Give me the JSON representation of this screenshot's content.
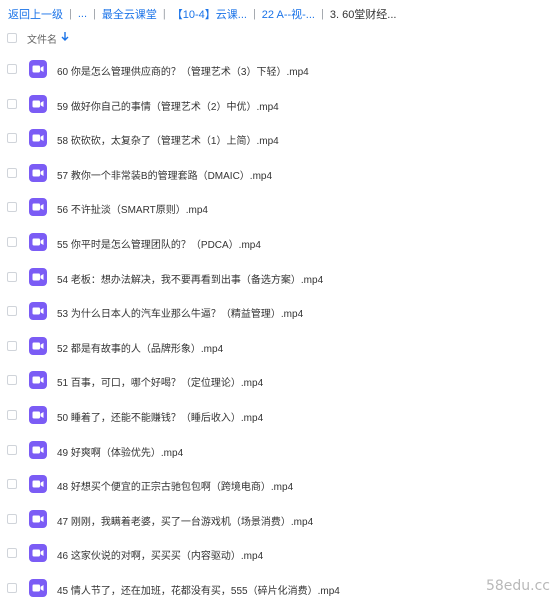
{
  "breadcrumb": {
    "items": [
      "返回上一级",
      "...",
      "最全云课堂",
      "【10-4】云课...",
      "22 A--视-...",
      "3. 60堂财经..."
    ],
    "separator": "|",
    "current_index": 5
  },
  "header": {
    "column_title": "文件名",
    "sort_icon": "arrow-down-icon"
  },
  "files": [
    {
      "name": "60 你是怎么管理供应商的？（管理艺术（3）下轻）.mp4",
      "icon": "video-icon"
    },
    {
      "name": "59 做好你自己的事情（管理艺术（2）中优）.mp4",
      "icon": "video-icon"
    },
    {
      "name": "58 砍砍砍，太复杂了（管理艺术（1）上简）.mp4",
      "icon": "video-icon"
    },
    {
      "name": "57 教你一个非常装B的管理套路（DMAIC）.mp4",
      "icon": "video-icon"
    },
    {
      "name": "56 不许扯淡（SMART原则）.mp4",
      "icon": "video-icon"
    },
    {
      "name": "55 你平时是怎么管理团队的？（PDCA）.mp4",
      "icon": "video-icon"
    },
    {
      "name": "54 老板：想办法解决，我不要再看到出事（备选方案）.mp4",
      "icon": "video-icon"
    },
    {
      "name": "53 为什么日本人的汽车业那么牛逼？（精益管理）.mp4",
      "icon": "video-icon"
    },
    {
      "name": "52 都是有故事的人（品牌形象）.mp4",
      "icon": "video-icon"
    },
    {
      "name": "51 百事，可口，哪个好喝？（定位理论）.mp4",
      "icon": "video-icon"
    },
    {
      "name": "50 睡着了，还能不能赚钱？（睡后收入）.mp4",
      "icon": "video-icon"
    },
    {
      "name": "49 好爽啊（体验优先）.mp4",
      "icon": "video-icon"
    },
    {
      "name": "48 好想买个便宜的正宗古驰包包啊（跨境电商）.mp4",
      "icon": "video-icon"
    },
    {
      "name": "47 刚刚，我瞒着老婆，买了一台游戏机（场景消费）.mp4",
      "icon": "video-icon"
    },
    {
      "name": "46 这家伙说的对啊，买买买（内容驱动）.mp4",
      "icon": "video-icon"
    },
    {
      "name": "45 情人节了，还在加班，花都没有买，555（碎片化消费）.mp4",
      "icon": "video-icon"
    }
  ],
  "colors": {
    "link": "#1a73e8",
    "video_icon_bg": "#7b5cf5",
    "text": "#333333"
  },
  "watermark": "58edu.cc"
}
